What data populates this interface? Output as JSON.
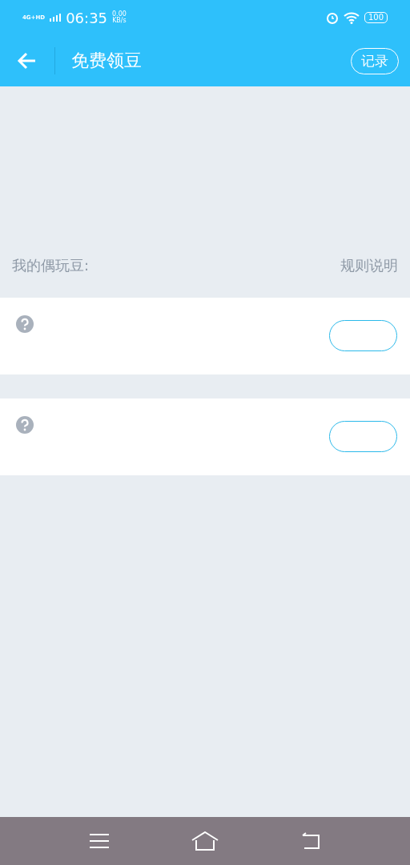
{
  "status_bar": {
    "network": "4G+HD",
    "time": "06:35",
    "speed": "0.00",
    "speed_unit": "KB/s",
    "battery": "100"
  },
  "header": {
    "title": "免费领豆",
    "action": "记录"
  },
  "summary": {
    "label": "我的偶玩豆:",
    "rules_link": "规则说明"
  },
  "tasks": [
    {
      "kind": "task"
    },
    {
      "kind": "task"
    }
  ]
}
